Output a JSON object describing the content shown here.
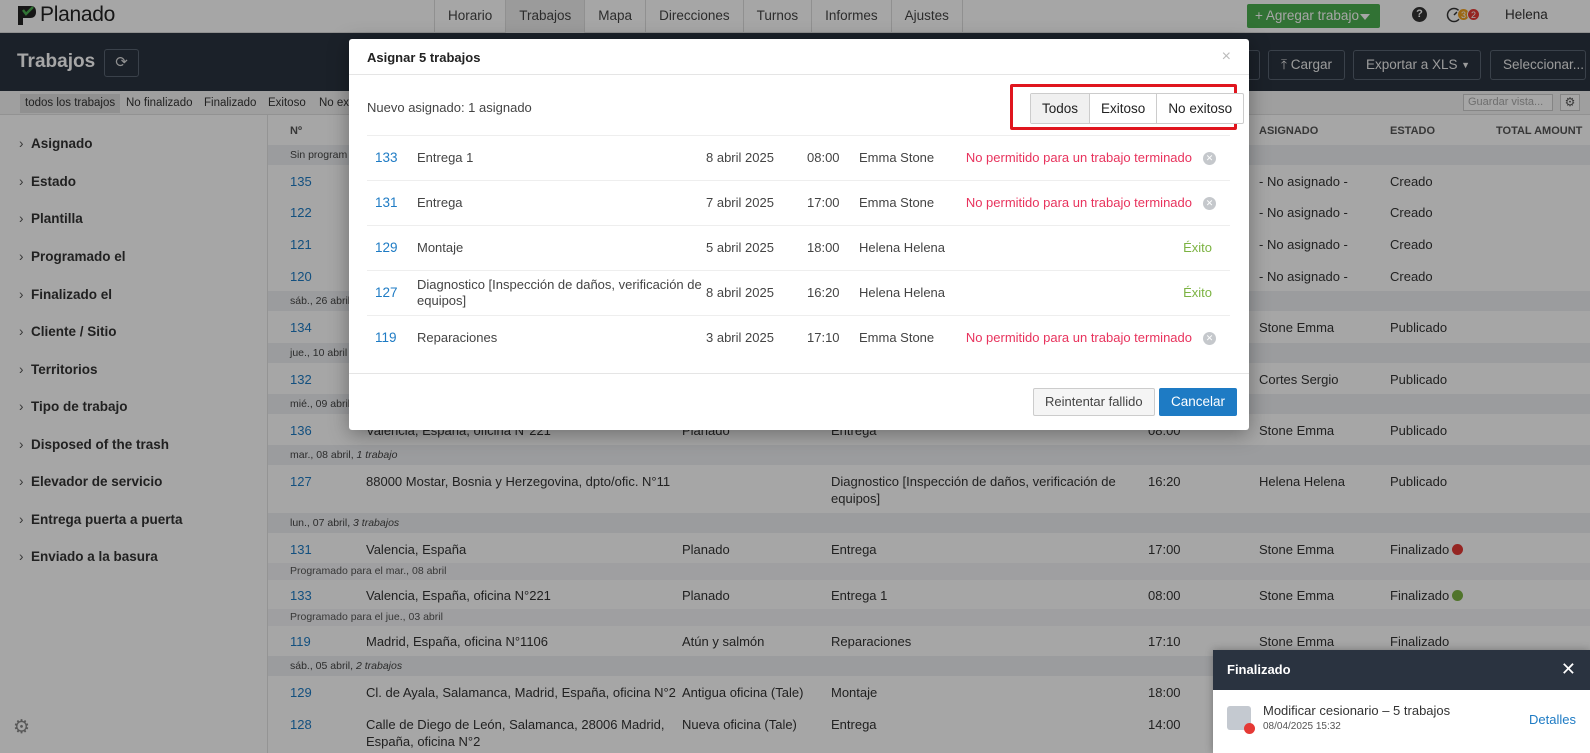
{
  "app": {
    "logo_text": "Planado",
    "user": "Helena Helena",
    "add_job_label": "+ Agregar trabajo",
    "help_label": "?",
    "badges": [
      "3",
      "2"
    ]
  },
  "nav": [
    "Horario",
    "Trabajos",
    "Mapa",
    "Direcciones",
    "Turnos",
    "Informes",
    "Ajustes"
  ],
  "header": {
    "title": "Trabajos",
    "upload_label": "Cargar",
    "export_label": "Exportar a XLS",
    "select_label": "Seleccionar..."
  },
  "filters": {
    "tabs": [
      "todos los trabajos",
      "No finalizado",
      "Finalizado",
      "Exitoso",
      "No exi"
    ],
    "save_view_placeholder": "Guardar vista..."
  },
  "sidebar": [
    "Asignado",
    "Estado",
    "Plantilla",
    "Programado el",
    "Finalizado el",
    "Cliente / Sitio",
    "Territorios",
    "Tipo de trabajo",
    "Disposed of the trash",
    "Elevador de servicio",
    "Entrega puerta a puerta",
    "Enviado a la basura"
  ],
  "table": {
    "headers": {
      "num": "Nº",
      "assigned": "ASIGNADO",
      "status": "ESTADO",
      "total": "TOTAL AMOUNT"
    },
    "groups": {
      "unscheduled": "Sin program",
      "sat26": "sáb., 26 abril",
      "thu10": "jue., 10 abril",
      "wed09": "mié., 09 abril",
      "tue08": "mar., 08 abril,",
      "tue08_count": "1 trabajo",
      "mon07": "lun., 07 abril,",
      "mon07_count": "3 trabajos",
      "sat05": "sáb., 05 abril,",
      "sat05_count": "2 trabajos"
    },
    "subs": {
      "s1": "Programado para el mar., 08 abril",
      "s2": "Programado para el jue., 03 abril"
    },
    "rows": [
      {
        "num": "135",
        "assigned": "- No asignado -",
        "status": "Creado"
      },
      {
        "num": "122",
        "assigned": "- No asignado -",
        "status": "Creado"
      },
      {
        "num": "121",
        "assigned": "- No asignado -",
        "status": "Creado"
      },
      {
        "num": "120",
        "assigned": "- No asignado -",
        "status": "Creado"
      },
      {
        "num": "134",
        "assigned": "Stone Emma",
        "status": "Publicado"
      },
      {
        "num": "132",
        "assigned": "Cortes Sergio",
        "status": "Publicado"
      },
      {
        "num": "136",
        "address": "Valencia, España, oficina N°221",
        "site": "Planado",
        "type": "Entrega",
        "time": "08:00",
        "assigned": "Stone Emma",
        "status": "Publicado"
      },
      {
        "num": "127",
        "address": "88000 Mostar, Bosnia y Herzegovina, dpto/ofic. N°11",
        "site": "",
        "type": "Diagnostico [Inspección de daños, verificación de",
        "type2": "equipos]",
        "time": "16:20",
        "assigned": "Helena Helena",
        "status": "Publicado"
      },
      {
        "num": "131",
        "address": "Valencia, España",
        "site": "Planado",
        "type": "Entrega",
        "time": "17:00",
        "assigned": "Stone Emma",
        "status": "Finalizado"
      },
      {
        "num": "133",
        "address": "Valencia, España, oficina N°221",
        "site": "Planado",
        "type": "Entrega 1",
        "time": "08:00",
        "assigned": "Stone Emma",
        "status": "Finalizado"
      },
      {
        "num": "119",
        "address": "Madrid, España, oficina N°1106",
        "site": "Atún y salmón",
        "type": "Reparaciones",
        "time": "17:10",
        "assigned": "Stone Emma",
        "status": "Finalizado"
      },
      {
        "num": "129",
        "address": "Cl. de Ayala, Salamanca, Madrid, España, oficina N°2",
        "site": "Antigua oficina (Tale)",
        "type": "Montaje",
        "time": "18:00"
      },
      {
        "num": "128",
        "address": "Calle de Diego de León, Salamanca, 28006 Madrid,",
        "address2": "España, oficina N°2",
        "site": "Nueva oficina (Tale)",
        "type": "Entrega",
        "time": "14:00"
      }
    ]
  },
  "modal": {
    "title": "Asignar 5 trabajos",
    "close": "×",
    "info": "Nuevo asignado: 1 asignado",
    "segments": [
      "Todos",
      "Exitoso",
      "No exitoso"
    ],
    "rows": [
      {
        "num": "133",
        "name": "Entrega 1",
        "date": "8 abril 2025",
        "time": "08:00",
        "person": "Emma Stone",
        "result": "No permitido para un trabajo terminado",
        "ok": false
      },
      {
        "num": "131",
        "name": "Entrega",
        "date": "7 abril 2025",
        "time": "17:00",
        "person": "Emma Stone",
        "result": "No permitido para un trabajo terminado",
        "ok": false
      },
      {
        "num": "129",
        "name": "Montaje",
        "date": "5 abril 2025",
        "time": "18:00",
        "person": "Helena Helena",
        "result": "Éxito",
        "ok": true
      },
      {
        "num": "127",
        "name": "Diagnostico [Inspección de daños, verificación de equipos]",
        "date": "8 abril 2025",
        "time": "16:20",
        "person": "Helena Helena",
        "result": "Éxito",
        "ok": true
      },
      {
        "num": "119",
        "name": "Reparaciones",
        "date": "3 abril 2025",
        "time": "17:10",
        "person": "Emma Stone",
        "result": "No permitido para un trabajo terminado",
        "ok": false
      }
    ],
    "retry_label": "Reintentar fallido",
    "cancel_label": "Cancelar"
  },
  "toast": {
    "title": "Finalizado",
    "message": "Modificar cesionario – 5 trabajos",
    "time": "08/04/2025 15:32",
    "link": "Detalles"
  },
  "colors": {
    "accent": "#1e7bc4",
    "error": "#e8335d",
    "success": "#7cb342",
    "add_button": "#4caf50",
    "header_bg": "#2a3340",
    "highlight": "#e0151e"
  }
}
